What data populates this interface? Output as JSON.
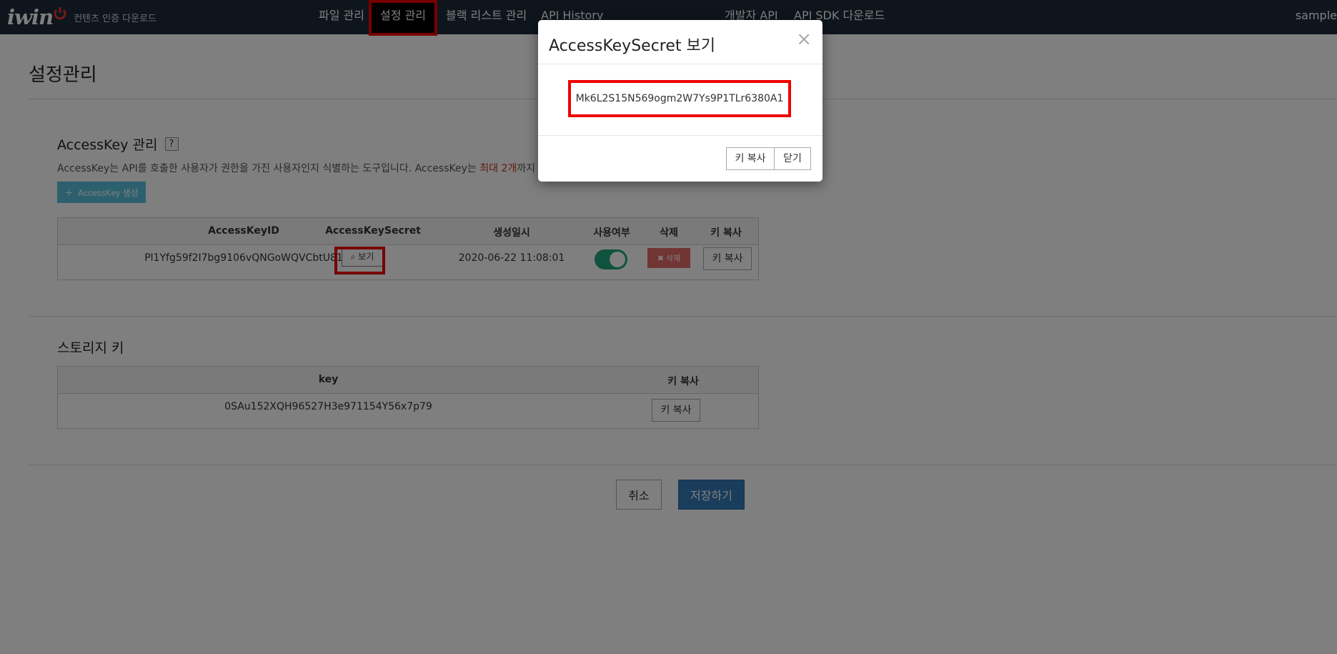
{
  "nav": {
    "logo": "iwin",
    "subtitle": "컨텐츠 인증 다운로드",
    "items": [
      "파일 관리",
      "설정 관리",
      "블랙 리스트 관리",
      "API History",
      "개발자 API",
      "API SDK 다운로드"
    ],
    "user": "sample"
  },
  "page": {
    "title": "설정관리"
  },
  "accesskey": {
    "title": "AccessKey 관리",
    "help": "?",
    "desc_pre": "AccessKey는 API를 호출한 사용자가 권한을 가진 사용자인지 식별하는 도구입니다. AccessKey는 ",
    "desc_highlight": "최대 2개",
    "desc_post": "까지 생성",
    "create_label": "AccessKey 생성",
    "columns": [
      "AccessKeyID",
      "AccessKeySecret",
      "생성일시",
      "사용여부",
      "삭제",
      "키 복사"
    ],
    "row": {
      "id": "Pl1Yfg59f2I7bg9106vQNGoWQVCbtU81",
      "view_label": "보기",
      "created": "2020-06-22 11:08:01",
      "enabled": true,
      "delete_label": "삭제",
      "copy_label": "키 복사"
    }
  },
  "storage": {
    "title": "스토리지 키",
    "columns": [
      "key",
      "키 복사"
    ],
    "row": {
      "key": "0SAu152XQH96527H3e971154Y56x7p79",
      "copy_label": "키 복사"
    }
  },
  "footer": {
    "cancel": "취소",
    "save": "저장하기"
  },
  "modal": {
    "title": "AccessKeySecret 보기",
    "close": "×",
    "secret": "Mk6L2S15N569ogm2W7Ys9P1TLr6380A1",
    "copy_label": "키 복사",
    "close_label": "닫기"
  },
  "colors": {
    "highlight": "#ee0000",
    "nav_bg": "#1c2b3a",
    "create_btn": "#5bc0de",
    "toggle_on": "#1ea57b",
    "save_btn": "#337ab7"
  }
}
